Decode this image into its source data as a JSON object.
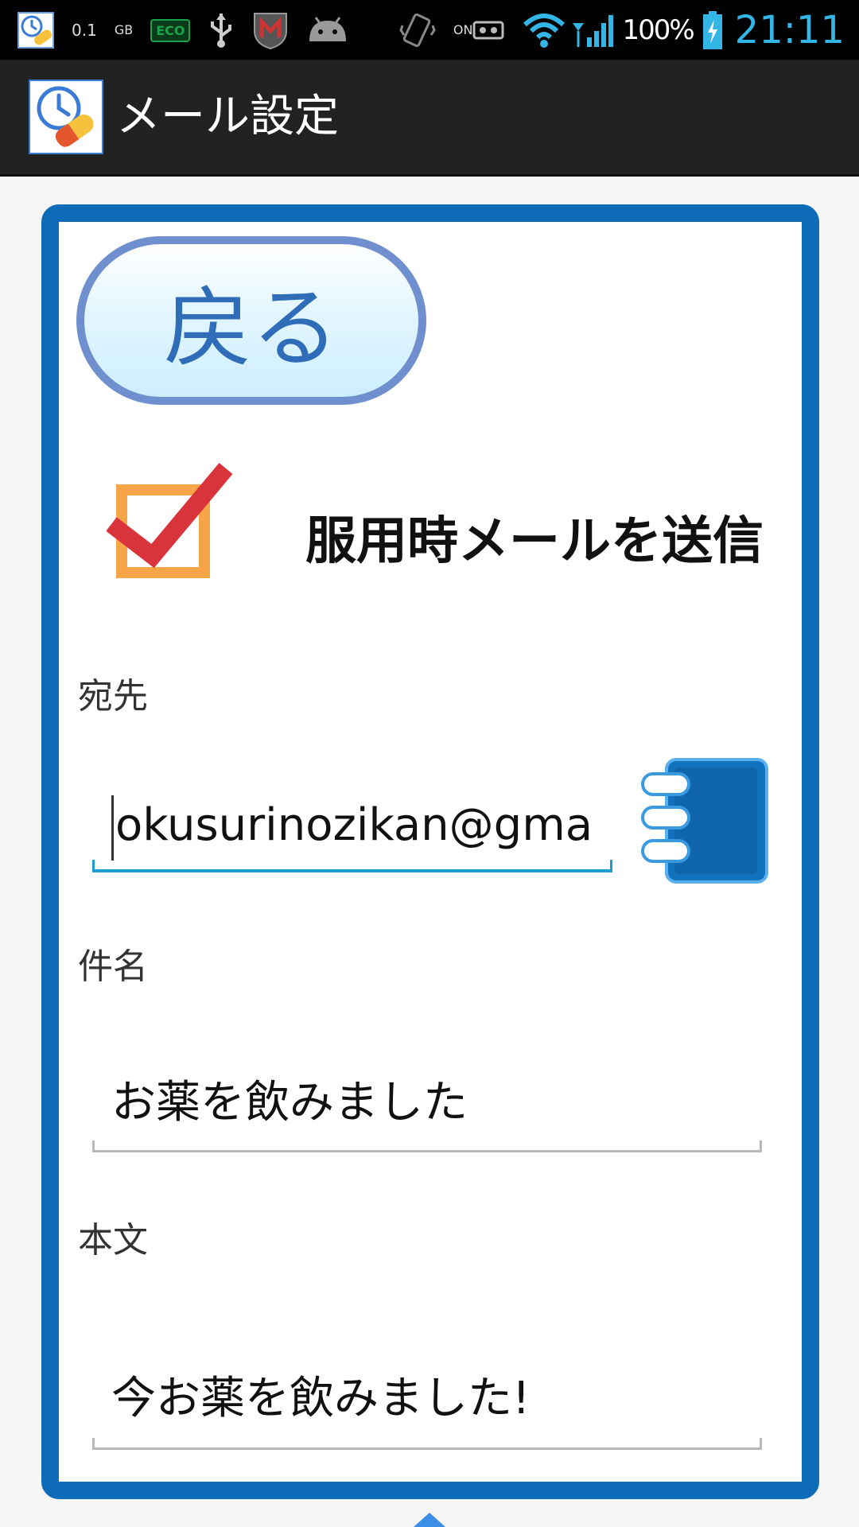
{
  "status_bar": {
    "memory_value": "0.1",
    "memory_unit": "GB",
    "eco_label": "ECO",
    "on_label": "ON",
    "battery_percent": "100%",
    "clock": "21:11",
    "icons": [
      "app-notification-icon",
      "memory-icon",
      "eco-icon",
      "usb-icon",
      "mcafee-icon",
      "android-debug-icon",
      "vibrate-icon",
      "on-recording-icon",
      "wifi-icon",
      "signal-icon",
      "battery-icon"
    ]
  },
  "action_bar": {
    "title": "メール設定",
    "icon": "clock-pill-icon"
  },
  "form": {
    "back_label": "戻る",
    "send_mail_label": "服用時メールを送信",
    "send_mail_checked": true,
    "to_label": "宛先",
    "to_value": "okusurinozikan@gma",
    "address_book_icon": "address-book-icon",
    "subject_label": "件名",
    "subject_value": "お薬を飲みました",
    "body_label": "本文",
    "body_value": "今お薬を飲みました!"
  },
  "colors": {
    "card_border": "#0d6bb8",
    "checkbox_border": "#f6a646",
    "check_mark": "#d9343c",
    "focus_underline": "#1e9bd0",
    "clock": "#33b5e5"
  }
}
